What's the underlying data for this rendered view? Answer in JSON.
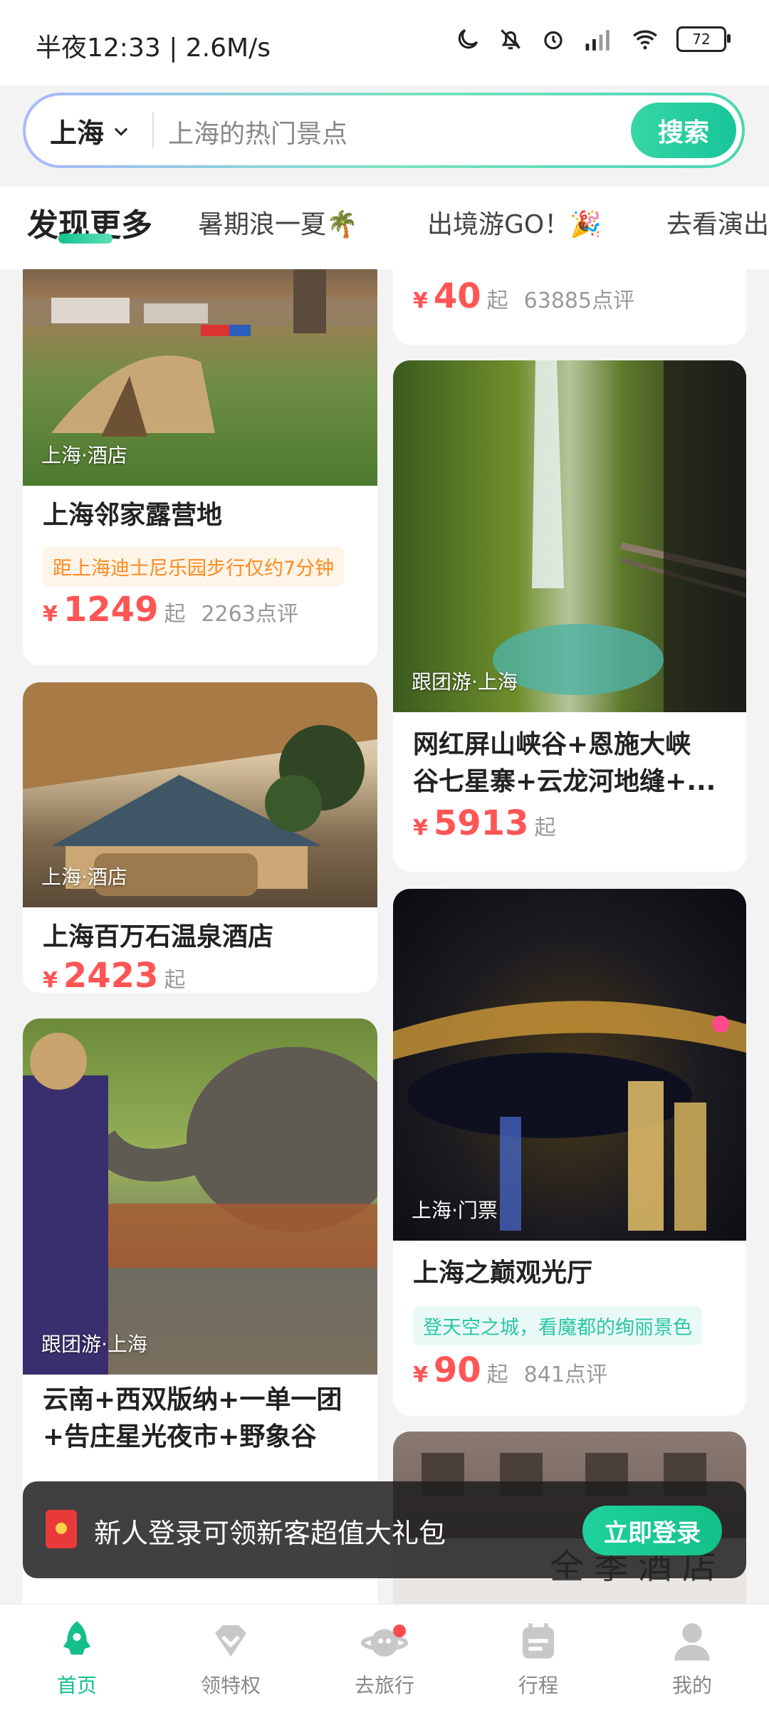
{
  "status_bar": {
    "time_speed": "半夜12:33 | 2.6M/s",
    "battery": "72"
  },
  "search": {
    "city": "上海",
    "placeholder": "上海的热门景点",
    "button": "搜索"
  },
  "tabs": [
    {
      "label": "发现更多"
    },
    {
      "label": "暑期浪一夏🌴"
    },
    {
      "label": "出境游GO！🎉"
    },
    {
      "label": "去看演出"
    }
  ],
  "cards_left": [
    {
      "tag": "上海·酒店",
      "title": "上海邻家露营地",
      "highlight": "距上海迪士尼乐园步行仅约7分钟",
      "price": "1249",
      "qi": "起",
      "reviews": "2263点评"
    },
    {
      "tag": "上海·酒店",
      "title": "上海百万石温泉酒店",
      "price": "2423",
      "qi": "起"
    },
    {
      "tag": "跟团游·上海",
      "title": "云南+西双版纳+一单一团",
      "title2": "+告庄星光夜市+野象谷"
    }
  ],
  "cards_right": [
    {
      "price": "40",
      "qi": "起",
      "reviews": "63885点评"
    },
    {
      "tag": "跟团游·上海",
      "title": "网红屏山峡谷+恩施大峡",
      "title2": "谷七星寨+云龙河地缝+...",
      "price": "5913",
      "qi": "起"
    },
    {
      "tag": "上海·门票",
      "title": "上海之巅观光厅",
      "highlight": "登天空之城，看魔都的绚丽景色",
      "price": "90",
      "qi": "起",
      "reviews": "841点评"
    },
    {
      "sign_text": "全季酒店"
    }
  ],
  "currency": "¥",
  "login_banner": {
    "text": "新人登录可领新客超值大礼包",
    "button": "立即登录"
  },
  "nav": [
    {
      "label": "首页",
      "icon": "rocket-icon"
    },
    {
      "label": "领特权",
      "icon": "diamond-icon"
    },
    {
      "label": "去旅行",
      "icon": "planet-icon"
    },
    {
      "label": "行程",
      "icon": "calendar-icon"
    },
    {
      "label": "我的",
      "icon": "user-icon"
    }
  ],
  "colors": {
    "accent": "#14bf8a",
    "price": "#ff5555",
    "highlight_orange": "#ff8a1f",
    "highlight_teal": "#2cc5a6"
  }
}
